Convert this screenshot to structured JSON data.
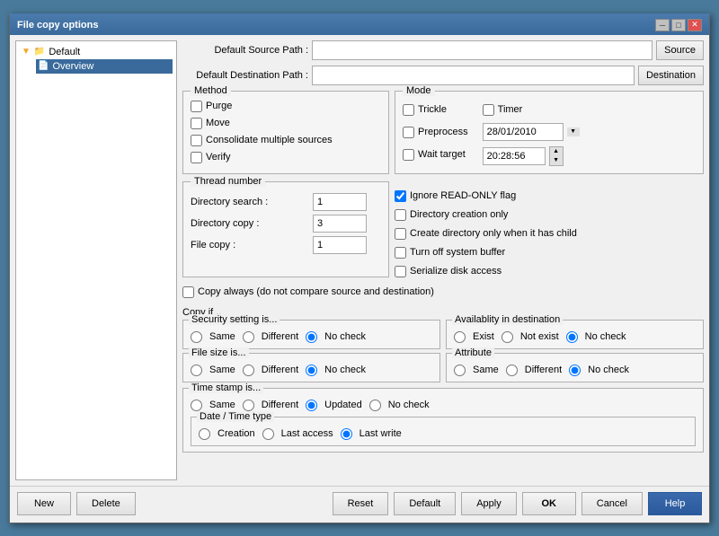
{
  "title": "File copy options",
  "titlebar": {
    "label": "File copy options",
    "close": "✕",
    "minimize": "─",
    "maximize": "□"
  },
  "tree": {
    "items": [
      {
        "id": "default",
        "label": "Default",
        "icon": "📁",
        "selected": false
      },
      {
        "id": "overview",
        "label": "Overview",
        "icon": "📄",
        "selected": true
      }
    ]
  },
  "paths": {
    "source_label": "Default Source Path :",
    "source_value": "",
    "source_btn": "Source",
    "dest_label": "Default Destination Path :",
    "dest_value": "",
    "dest_btn": "Destination"
  },
  "method": {
    "title": "Method",
    "purge_label": "Purge",
    "purge_checked": false,
    "move_label": "Move",
    "move_checked": false,
    "consolidate_label": "Consolidate multiple sources",
    "consolidate_checked": false,
    "verify_label": "Verify",
    "verify_checked": false
  },
  "mode": {
    "title": "Mode",
    "trickle_label": "Trickle",
    "trickle_checked": false,
    "timer_label": "Timer",
    "timer_checked": false,
    "preprocess_label": "Preprocess",
    "preprocess_checked": false,
    "date_value": "28/01/2010",
    "wait_target_label": "Wait target",
    "wait_target_checked": false,
    "time_value": "20:28:56"
  },
  "thread": {
    "title": "Thread number",
    "dir_search_label": "Directory search :",
    "dir_search_value": "1",
    "dir_copy_label": "Directory copy :",
    "dir_copy_value": "3",
    "file_copy_label": "File copy :",
    "file_copy_value": "1"
  },
  "flags": {
    "ignore_readonly_label": "Ignore READ-ONLY flag",
    "ignore_readonly_checked": true,
    "dir_creation_label": "Directory creation only",
    "dir_creation_checked": false,
    "create_dir_label": "Create directory only when it has child",
    "create_dir_checked": false,
    "turn_off_buffer_label": "Turn off system buffer",
    "turn_off_buffer_checked": false,
    "serialize_label": "Serialize disk access",
    "serialize_checked": false
  },
  "copy_always": {
    "label": "Copy always (do not compare source and destination)",
    "checked": false
  },
  "copy_if": {
    "label": "Copy if ..",
    "security": {
      "title": "Security setting is...",
      "same_label": "Same",
      "different_label": "Different",
      "no_check_label": "No check",
      "selected": "no_check"
    },
    "availability": {
      "title": "Availablity in destination",
      "exist_label": "Exist",
      "not_exist_label": "Not exist",
      "no_check_label": "No check",
      "selected": "no_check"
    },
    "file_size": {
      "title": "File size is...",
      "same_label": "Same",
      "different_label": "Different",
      "no_check_label": "No check",
      "selected": "no_check"
    },
    "attribute": {
      "title": "Attribute",
      "same_label": "Same",
      "different_label": "Different",
      "no_check_label": "No check",
      "selected": "no_check"
    },
    "timestamp": {
      "title": "Time stamp is...",
      "same_label": "Same",
      "different_label": "Different",
      "updated_label": "Updated",
      "no_check_label": "No check",
      "selected": "updated"
    },
    "datetime_type": {
      "title": "Date / Time type",
      "creation_label": "Creation",
      "last_access_label": "Last access",
      "last_write_label": "Last write",
      "selected": "last_write"
    }
  },
  "buttons": {
    "new_label": "New",
    "delete_label": "Delete",
    "reset_label": "Reset",
    "default_label": "Default",
    "apply_label": "Apply",
    "ok_label": "OK",
    "cancel_label": "Cancel",
    "help_label": "Help"
  }
}
